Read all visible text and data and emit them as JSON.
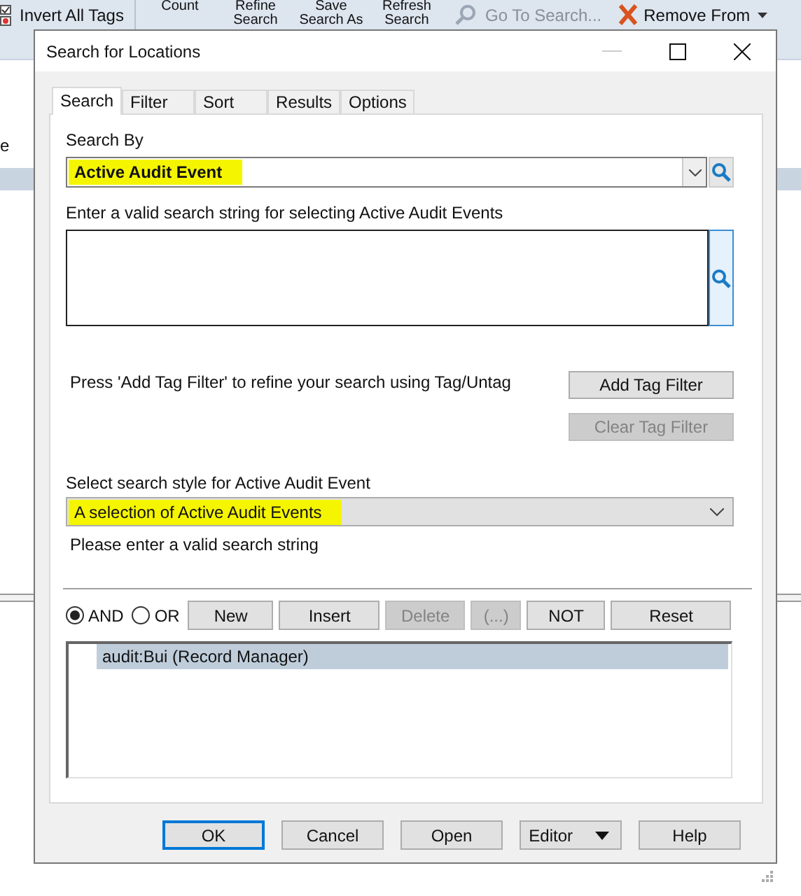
{
  "ribbon": {
    "items": [
      {
        "label": "Invert All Tags",
        "kind": "tags",
        "disabled": false
      },
      {
        "label": "Count",
        "kind": "large",
        "disabled": false
      },
      {
        "label": "Refine Search",
        "kind": "large",
        "disabled": false
      },
      {
        "label": "Save Search As",
        "kind": "large",
        "disabled": false
      },
      {
        "label": "Refresh Search",
        "kind": "large",
        "disabled": false
      },
      {
        "label": "Go To Search...",
        "kind": "search",
        "disabled": true
      },
      {
        "label": "Remove From",
        "kind": "remove",
        "disabled": false
      }
    ]
  },
  "background": {
    "column_header": "e"
  },
  "dialog": {
    "title": "Search for Locations",
    "tabs": [
      {
        "label": "Search",
        "selected": true
      },
      {
        "label": "Filter",
        "selected": false
      },
      {
        "label": "Sort",
        "selected": false
      },
      {
        "label": "Results",
        "selected": false
      },
      {
        "label": "Options",
        "selected": false
      }
    ],
    "search_by": {
      "label": "Search By",
      "value": "Active Audit Event",
      "highlighted": true
    },
    "search_string": {
      "label": "Enter a valid search string for selecting Active Audit Events"
    },
    "tag_hint": "Press 'Add Tag Filter' to refine your search using Tag/Untag",
    "tag_buttons": [
      {
        "label": "Add Tag Filter",
        "disabled": false
      },
      {
        "label": "Clear Tag Filter",
        "disabled": true
      }
    ],
    "search_style": {
      "label": "Select search style for Active Audit Event",
      "value": "A selection of Active Audit Events",
      "highlighted": true
    },
    "status": "Please enter a valid search string",
    "operators": [
      {
        "label": "AND",
        "selected": true
      },
      {
        "label": "OR",
        "selected": false
      }
    ],
    "criteria_buttons": [
      {
        "label": "New",
        "disabled": false
      },
      {
        "label": "Insert",
        "disabled": false
      },
      {
        "label": "Delete",
        "disabled": true
      },
      {
        "label": "(...)",
        "disabled": true
      },
      {
        "label": "NOT",
        "disabled": false
      },
      {
        "label": "Reset",
        "disabled": false
      }
    ],
    "criteria": [
      {
        "text": "audit:Bui (Record Manager)",
        "selected": true
      }
    ],
    "footer_buttons": [
      {
        "label": "OK",
        "default": true,
        "dropdown": false
      },
      {
        "label": "Cancel",
        "default": false,
        "dropdown": false
      },
      {
        "label": "Open",
        "default": false,
        "dropdown": false
      },
      {
        "label": "Editor",
        "default": false,
        "dropdown": true
      },
      {
        "label": "Help",
        "default": false,
        "dropdown": false
      }
    ]
  }
}
